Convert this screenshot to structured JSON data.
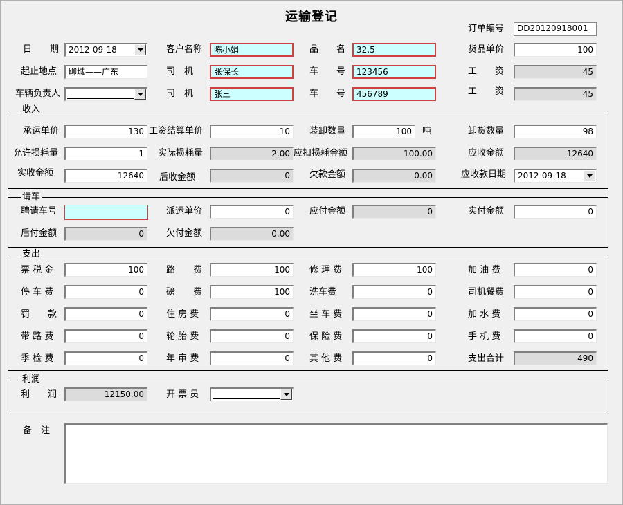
{
  "form": {
    "title": "运输登记"
  },
  "order": {
    "label": "订单编号",
    "value": "DD20120918001"
  },
  "header": {
    "date": {
      "label": "日　　期",
      "value": "2012-09-18"
    },
    "route": {
      "label": "起止地点",
      "value": "聊城——广东"
    },
    "vehicle_manager": {
      "label": "车辆负责人",
      "value": ""
    },
    "customer": {
      "label": "客户名称",
      "value": "陈小娟"
    },
    "driver1": {
      "label": "司　机",
      "value": "张保长"
    },
    "driver2": {
      "label": "司　机",
      "value": "张三"
    },
    "product": {
      "label": "品　　名",
      "value": "32.5"
    },
    "plate1": {
      "label": "车　　号",
      "value": "123456"
    },
    "plate2": {
      "label": "车　　号",
      "value": "456789"
    },
    "unit_price": {
      "label": "货品单价",
      "value": "100"
    },
    "wage1": {
      "label": "工　　资",
      "value": "45"
    },
    "wage2": {
      "label": "工　　资",
      "value": "45"
    }
  },
  "income": {
    "title": "收入",
    "carriage_price": {
      "label": "承运单价",
      "value": "130"
    },
    "wage_unit_price": {
      "label": "工资结算单价",
      "value": "10"
    },
    "load_qty": {
      "label": "装卸数量",
      "value": "100",
      "unit": "吨"
    },
    "unload_qty": {
      "label": "卸货数量",
      "value": "98"
    },
    "allowed_loss": {
      "label": "允许损耗量",
      "value": "1"
    },
    "actual_loss": {
      "label": "实际损耗量",
      "value": "2.00"
    },
    "loss_deduction": {
      "label": "应扣损耗金额",
      "value": "100.00"
    },
    "receivable": {
      "label": "应收金额",
      "value": "12640"
    },
    "received": {
      "label": "实收金额",
      "value": "12640"
    },
    "later_received": {
      "label": "后收金额",
      "value": "0"
    },
    "arrears": {
      "label": "欠款金额",
      "value": "0.00"
    },
    "receivable_date": {
      "label": "应收款日期",
      "value": "2012-09-18"
    }
  },
  "hire": {
    "title": "请车",
    "hired_plate": {
      "label": "聘请车号",
      "value": ""
    },
    "dispatch_price": {
      "label": "派运单价",
      "value": "0"
    },
    "payable": {
      "label": "应付金额",
      "value": "0"
    },
    "paid": {
      "label": "实付金额",
      "value": "0"
    },
    "later_paid": {
      "label": "后付金额",
      "value": "0"
    },
    "unpaid": {
      "label": "欠付金额",
      "value": "0.00"
    }
  },
  "expense": {
    "title": "支出",
    "ticket_tax": {
      "label": "票 税 金",
      "value": "100"
    },
    "road_fee": {
      "label": "路　　费",
      "value": "100"
    },
    "repair_fee": {
      "label": "修 理 费",
      "value": "100"
    },
    "fuel_fee": {
      "label": "加 油 费",
      "value": "0"
    },
    "parking_fee": {
      "label": "停 车 费",
      "value": "0"
    },
    "weigh_fee": {
      "label": "磅　　费",
      "value": "100"
    },
    "wash_fee": {
      "label": "洗车费",
      "value": "0"
    },
    "driver_meal": {
      "label": "司机餐费",
      "value": "0"
    },
    "fine": {
      "label": "罚　　款",
      "value": "0"
    },
    "lodging_fee": {
      "label": "住 房 费",
      "value": "0"
    },
    "ride_fee": {
      "label": "坐 车 费",
      "value": "0"
    },
    "water_fee": {
      "label": "加 水 费",
      "value": "0"
    },
    "road_pass_fee": {
      "label": "带 路 费",
      "value": "0"
    },
    "tire_fee": {
      "label": "轮 胎 费",
      "value": "0"
    },
    "insurance_fee": {
      "label": "保 险 费",
      "value": "0"
    },
    "phone_fee": {
      "label": "手 机 费",
      "value": "0"
    },
    "quarterly_check": {
      "label": "季 检 费",
      "value": "0"
    },
    "annual_check": {
      "label": "年 审 费",
      "value": "0"
    },
    "other_fee": {
      "label": "其 他 费",
      "value": "0"
    },
    "total": {
      "label": "支出合计",
      "value": "490"
    }
  },
  "profit": {
    "title": "利润",
    "profit": {
      "label": "利　　润",
      "value": "12150.00"
    },
    "invoicer": {
      "label": "开 票 员",
      "value": ""
    }
  },
  "remarks": {
    "label": "备　注",
    "value": ""
  }
}
